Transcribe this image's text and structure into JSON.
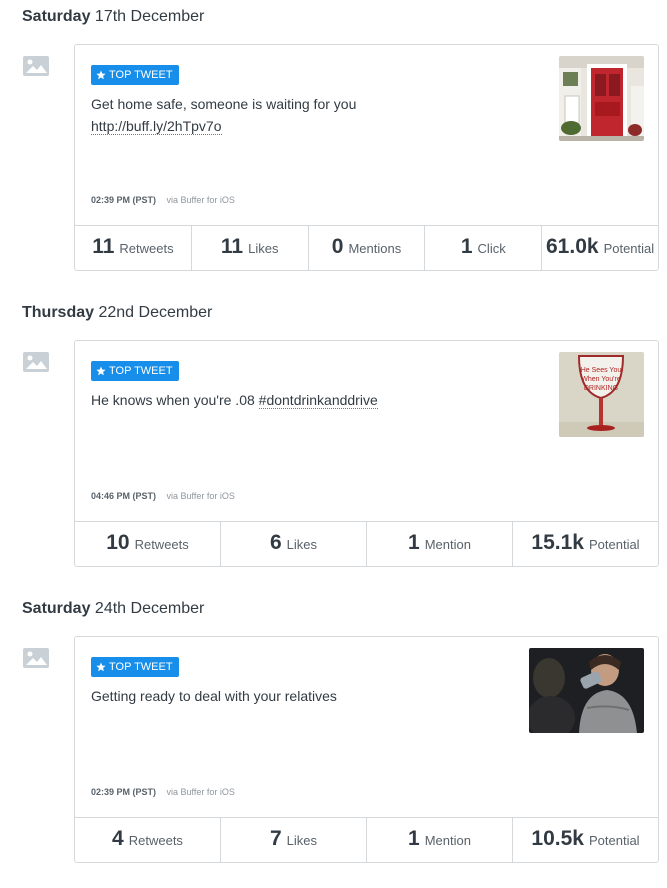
{
  "posts": [
    {
      "date_weekday": "Saturday",
      "date_rest": "17th December",
      "badge": "TOP TWEET",
      "text": "Get home safe, someone is waiting for you",
      "link": "http://buff.ly/2hTpv7o",
      "time": "02:39 PM (PST)",
      "via": "via Buffer for iOS",
      "thumb": "red-door-photo",
      "stats": [
        {
          "num": "11",
          "label": "Retweets"
        },
        {
          "num": "11",
          "label": "Likes"
        },
        {
          "num": "0",
          "label": "Mentions"
        },
        {
          "num": "1",
          "label": "Click"
        },
        {
          "num": "61.0k",
          "label": "Potential"
        }
      ]
    },
    {
      "date_weekday": "Thursday",
      "date_rest": "22nd December",
      "badge": "TOP TWEET",
      "text": "He knows when you're .08",
      "hashtag": "#dontdrinkanddrive",
      "time": "04:46 PM (PST)",
      "via": "via Buffer for iOS",
      "thumb": "wine-glass-photo",
      "thumb_text": "He Sees You When You're DRINKING",
      "stats": [
        {
          "num": "10",
          "label": "Retweets"
        },
        {
          "num": "6",
          "label": "Likes"
        },
        {
          "num": "1",
          "label": "Mention"
        },
        {
          "num": "15.1k",
          "label": "Potential"
        }
      ]
    },
    {
      "date_weekday": "Saturday",
      "date_rest": "24th December",
      "badge": "TOP TWEET",
      "text": "Getting ready to deal with your relatives",
      "time": "02:39 PM (PST)",
      "via": "via Buffer for iOS",
      "thumb": "person-drinking-photo",
      "stats": [
        {
          "num": "4",
          "label": "Retweets"
        },
        {
          "num": "7",
          "label": "Likes"
        },
        {
          "num": "1",
          "label": "Mention"
        },
        {
          "num": "10.5k",
          "label": "Potential"
        }
      ]
    }
  ],
  "icons": {
    "post_type": "image-icon",
    "badge": "star-icon"
  },
  "colors": {
    "accent": "#168eea",
    "border": "#d5d9dc",
    "text": "#323b43"
  }
}
